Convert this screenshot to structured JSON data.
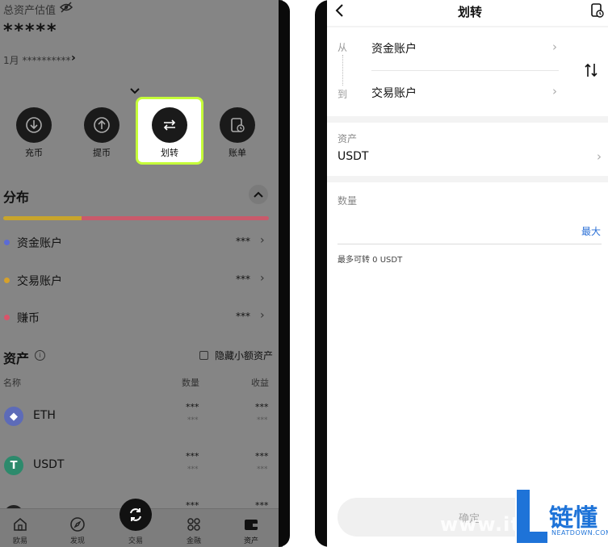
{
  "left": {
    "total_label": "总资产估值",
    "total_value": "*****",
    "month_label": "1月 **********",
    "actions": [
      {
        "label": "充币"
      },
      {
        "label": "提币"
      },
      {
        "label": "划转"
      },
      {
        "label": "账单"
      }
    ],
    "distribution_title": "分布",
    "accounts": [
      {
        "name": "资金账户",
        "value": "***",
        "color": "#5b6bd6"
      },
      {
        "name": "交易账户",
        "value": "***",
        "color": "#d6a12a"
      },
      {
        "name": "赚币",
        "value": "***",
        "color": "#d9546a"
      }
    ],
    "assets_title": "资产",
    "hide_small_label": "隐藏小额资产",
    "columns": {
      "name": "名称",
      "qty": "数量",
      "earn": "收益"
    },
    "coins": [
      {
        "symbol": "ETH",
        "qty": "***",
        "qty2": "***",
        "earn": "***",
        "earn2": "***"
      },
      {
        "symbol": "USDT",
        "qty": "***",
        "qty2": "***",
        "earn": "***",
        "earn2": "***"
      },
      {
        "symbol": "",
        "qty": "***",
        "earn": "***"
      }
    ],
    "nav": [
      {
        "label": "欧易"
      },
      {
        "label": "发现"
      },
      {
        "label": "交易"
      },
      {
        "label": "金融"
      },
      {
        "label": "资产"
      }
    ]
  },
  "right": {
    "title": "划转",
    "from_label": "从",
    "to_label": "到",
    "from_account": "资金账户",
    "to_account": "交易账户",
    "asset_label": "资产",
    "asset_value": "USDT",
    "qty_label": "数量",
    "max_label": "最大",
    "available": "最多可转 0 USDT",
    "confirm": "确定"
  },
  "watermark": {
    "brand": "链懂",
    "domain": "NEATDOWN.COM",
    "url_fragment": "www.itr"
  }
}
